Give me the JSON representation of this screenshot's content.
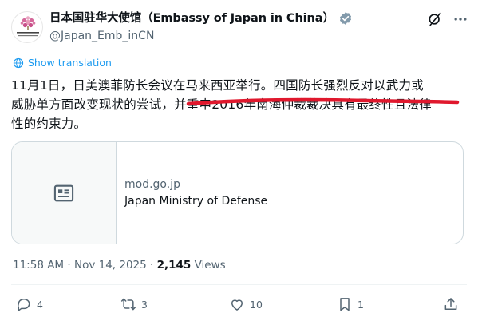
{
  "account": {
    "display_name": "日本国驻华大使馆（Embassy of Japan in China）",
    "handle": "@Japan_Emb_inCN",
    "verified_badge_color": "#829aab"
  },
  "header_icons": [
    "grok-icon",
    "more-icon"
  ],
  "translation": {
    "label": "Show translation"
  },
  "tweet": {
    "lines": [
      "11月1日，日美澳菲防长会议在马来西亚举行。四国防长强烈反对以武力或",
      "威胁单方面改变现状的尝试，并重申2016年南海仲裁裁决具有最终性且法律",
      "性的约束力。"
    ],
    "strikethrough_color": "#e0182d"
  },
  "link_card": {
    "domain": "mod.go.jp",
    "title": "Japan Ministry of Defense",
    "icon": "article-icon"
  },
  "meta": {
    "time": "11:58 AM",
    "separator": " · ",
    "date": "Nov 14, 2025",
    "dot": " · ",
    "views_count": "2,145",
    "views_label": " Views"
  },
  "actions": {
    "replies": "4",
    "reposts": "3",
    "likes": "10",
    "bookmarks": "1"
  },
  "accent_color": "#1d9bf0"
}
